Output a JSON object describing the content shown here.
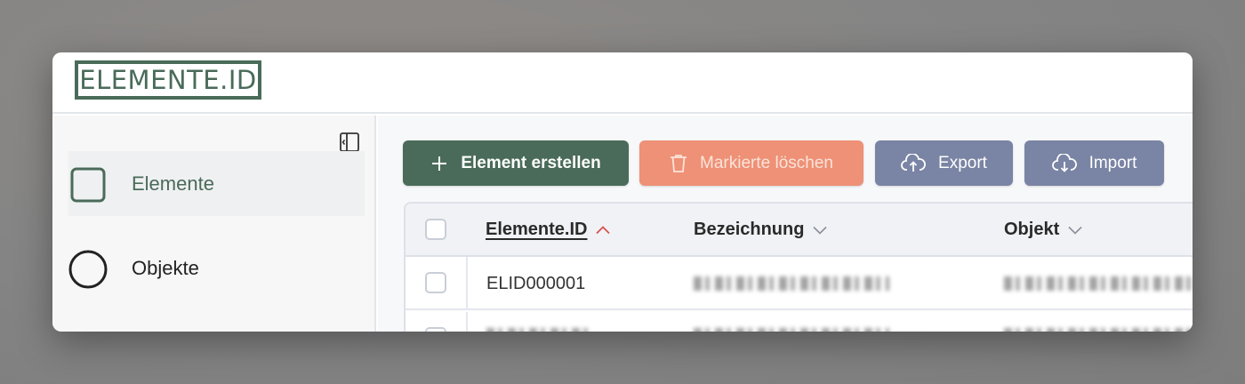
{
  "app": {
    "logo_text": "ELEMENTE.ID"
  },
  "sidebar": {
    "items": [
      {
        "label": "Elemente",
        "icon": "square-icon",
        "active": true
      },
      {
        "label": "Objekte",
        "icon": "circle-icon",
        "active": false
      }
    ]
  },
  "toolbar": {
    "create_label": "Element erstellen",
    "delete_label": "Markierte löschen",
    "export_label": "Export",
    "import_label": "Import"
  },
  "table": {
    "columns": [
      "Elemente.ID",
      "Bezeichnung",
      "Objekt"
    ],
    "sort": {
      "column": "Elemente.ID",
      "direction": "ascending"
    },
    "rows": [
      {
        "id": "ELID000001",
        "bezeichnung": "",
        "objekt": ""
      }
    ]
  },
  "colors": {
    "brand": "#4a6b59",
    "danger": "#ee9176",
    "secondary": "#7a84a4",
    "sort_indicator": "#d9534f"
  }
}
